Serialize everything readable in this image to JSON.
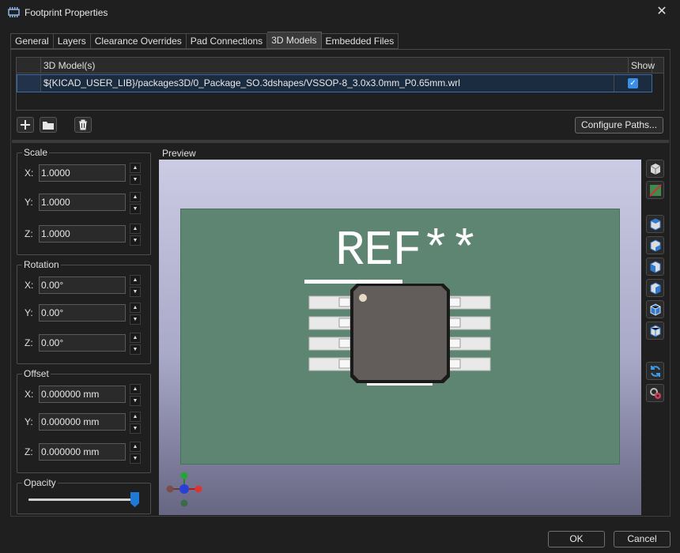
{
  "window": {
    "title": "Footprint Properties",
    "close_label": "✕"
  },
  "tabs": [
    {
      "label": "General"
    },
    {
      "label": "Layers"
    },
    {
      "label": "Clearance Overrides"
    },
    {
      "label": "Pad Connections"
    },
    {
      "label": "3D Models",
      "active": true
    },
    {
      "label": "Embedded Files"
    }
  ],
  "models_grid": {
    "col_model": "3D Model(s)",
    "col_show": "Show",
    "rows": [
      {
        "path": "${KICAD_USER_LIB}/packages3D/0_Package_SO.3dshapes/VSSOP-8_3.0x3.0mm_P0.65mm.wrl",
        "show": true
      }
    ]
  },
  "toolbar": {
    "add_icon": "plus-icon",
    "open_icon": "folder-icon",
    "delete_icon": "trash-icon",
    "configure_label": "Configure Paths..."
  },
  "scale": {
    "label": "Scale",
    "x_label": "X:",
    "y_label": "Y:",
    "z_label": "Z:",
    "x": "1.0000",
    "y": "1.0000",
    "z": "1.0000"
  },
  "rotation": {
    "label": "Rotation",
    "x_label": "X:",
    "y_label": "Y:",
    "z_label": "Z:",
    "x": "0.00°",
    "y": "0.00°",
    "z": "0.00°"
  },
  "offset": {
    "label": "Offset",
    "x_label": "X:",
    "y_label": "Y:",
    "z_label": "Z:",
    "x": "0.000000 mm",
    "y": "0.000000 mm",
    "z": "0.000000 mm"
  },
  "opacity": {
    "label": "Opacity",
    "value": 1.0
  },
  "preview": {
    "label": "Preview",
    "ref_text": "REF**",
    "board_color": "#5e8571",
    "silkscreen_color": "#ffffff",
    "body_color": "#625d5b"
  },
  "view_buttons": [
    "view-3d-icon",
    "board-body-toggle-icon",
    "view-top-icon",
    "view-bottom-icon",
    "view-left-icon",
    "view-right-icon",
    "view-front-icon",
    "view-back-icon",
    "reload-icon",
    "settings-icon"
  ],
  "footer": {
    "ok_label": "OK",
    "cancel_label": "Cancel"
  }
}
